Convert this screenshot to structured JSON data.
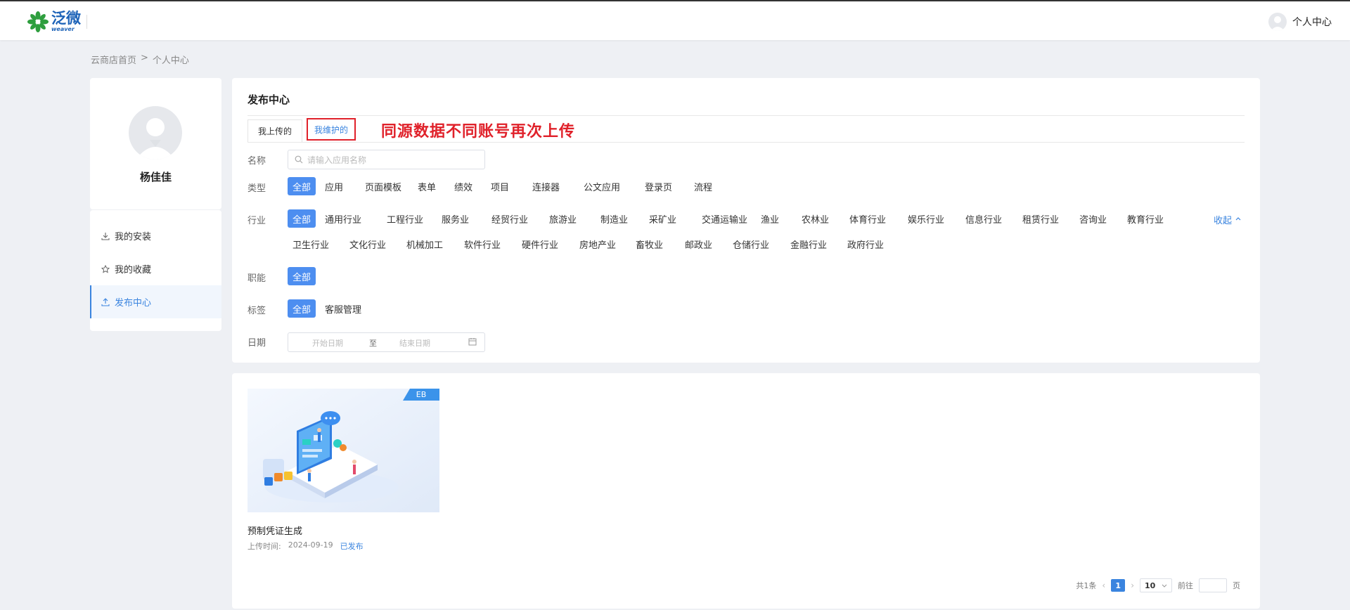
{
  "header": {
    "logo_cn": "泛微",
    "logo_en": "weaver",
    "user_label": "个人中心"
  },
  "breadcrumb": {
    "home": "云商店首页",
    "sep": ">",
    "current": "个人中心"
  },
  "profile": {
    "name": "杨佳佳"
  },
  "sidebar": {
    "items": [
      {
        "label": "我的安装"
      },
      {
        "label": "我的收藏"
      },
      {
        "label": "发布中心"
      }
    ]
  },
  "main": {
    "title": "发布中心",
    "tabs": [
      {
        "label": "我上传的"
      },
      {
        "label": "我维护的"
      }
    ],
    "annotation": "同源数据不同账号再次上传",
    "filters": {
      "name_label": "名称",
      "name_placeholder": "请输入应用名称",
      "type_label": "类型",
      "types": [
        "全部",
        "应用",
        "页面模板",
        "表单",
        "绩效",
        "项目",
        "连接器",
        "公文应用",
        "登录页",
        "流程"
      ],
      "industry_label": "行业",
      "industries_row1": [
        "全部",
        "通用行业",
        "工程行业",
        "服务业",
        "经贸行业",
        "旅游业",
        "制造业",
        "采矿业",
        "交通运输业",
        "渔业",
        "农林业",
        "体育行业",
        "娱乐行业",
        "信息行业",
        "租赁行业",
        "咨询业",
        "教育行业"
      ],
      "industries_row2": [
        "卫生行业",
        "文化行业",
        "机械加工",
        "软件行业",
        "硬件行业",
        "房地产业",
        "畜牧业",
        "邮政业",
        "仓储行业",
        "金融行业",
        "政府行业"
      ],
      "collapse_label": "收起",
      "function_label": "职能",
      "functions": [
        "全部"
      ],
      "tag_label": "标签",
      "tags": [
        "全部",
        "客服管理"
      ],
      "date_label": "日期",
      "date_start_placeholder": "开始日期",
      "date_sep": "至",
      "date_end_placeholder": "结束日期"
    }
  },
  "apps": [
    {
      "badge": "EB",
      "title": "预制凭证生成",
      "upload_label": "上传时间:",
      "upload_date": "2024-09-19",
      "status": "已发布"
    }
  ],
  "pagination": {
    "total": "共1条",
    "current_page": "1",
    "page_size": "10",
    "goto_label": "前往",
    "page_suffix": "页"
  },
  "colors": {
    "primary": "#4d8ef0",
    "link": "#3a84df",
    "annotation": "#e0212a",
    "background": "#eef0f4"
  }
}
